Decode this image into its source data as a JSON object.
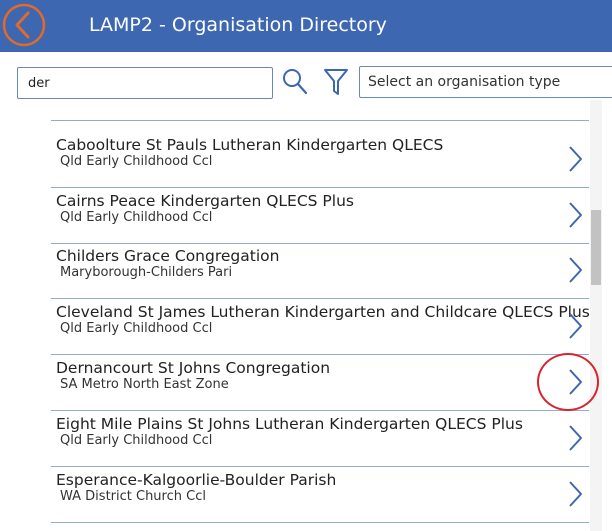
{
  "header": {
    "title": "LAMP2 - Organisation Directory",
    "back_icon": "chevron-left-icon",
    "accent": "#e06a2a",
    "bar_color": "#3e67b1"
  },
  "search": {
    "value": "der",
    "search_icon": "search-icon",
    "filter_icon": "filter-icon"
  },
  "org_type_select": {
    "placeholder": "Select an organisation type"
  },
  "list": {
    "items": [
      {
        "title": "Caboolture St Pauls Lutheran Kindergarten QLECS",
        "subtitle": "Qld Early Childhood Ccl"
      },
      {
        "title": "Cairns Peace Kindergarten QLECS Plus",
        "subtitle": "Qld Early Childhood Ccl"
      },
      {
        "title": "Childers Grace Congregation",
        "subtitle": "Maryborough-Childers Pari"
      },
      {
        "title": "Cleveland St James Lutheran Kindergarten and Childcare QLECS Plus",
        "subtitle": "Qld Early Childhood Ccl"
      },
      {
        "title": "Dernancourt St Johns Congregation",
        "subtitle": "SA Metro North East Zone"
      },
      {
        "title": "Eight Mile Plains St Johns Lutheran Kindergarten QLECS Plus",
        "subtitle": "Qld Early Childhood Ccl"
      },
      {
        "title": "Esperance-Kalgoorlie-Boulder Parish",
        "subtitle": "WA District Church Ccl"
      }
    ],
    "chevron_icon": "chevron-right-icon",
    "highlight_color": "#d9232d"
  }
}
